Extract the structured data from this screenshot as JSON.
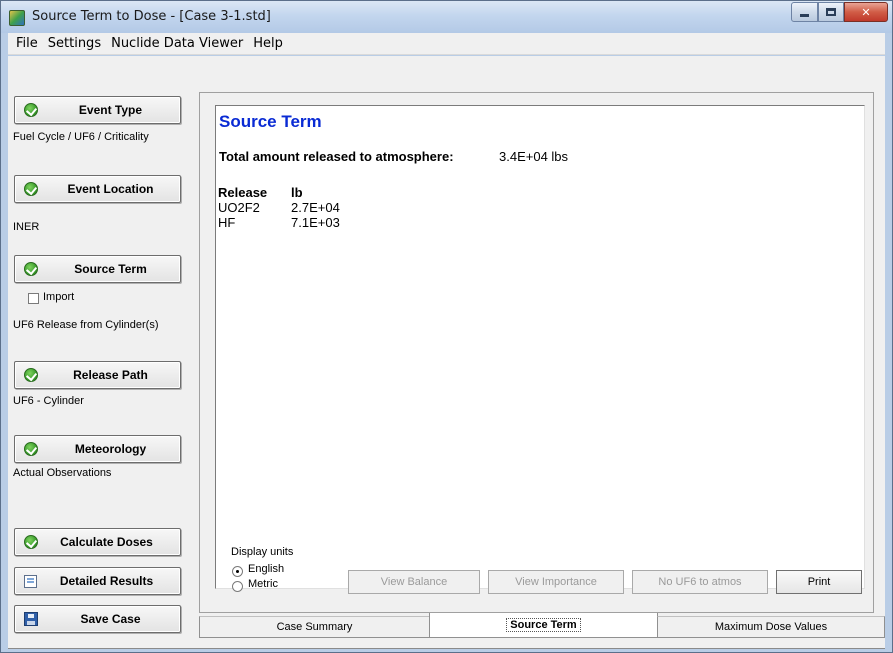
{
  "window": {
    "title": "Source Term to Dose - [Case 3-1.std]"
  },
  "menu": [
    "File",
    "Settings",
    "Nuclide Data Viewer",
    "Help"
  ],
  "steps": {
    "event_type": {
      "label": "Event Type",
      "description": "Fuel Cycle / UF6 / Criticality"
    },
    "event_location": {
      "label": "Event Location",
      "description": "INER"
    },
    "source_term": {
      "label": "Source Term",
      "description": "UF6 Release from Cylinder(s)"
    },
    "import": {
      "label": "Import",
      "checked": false
    },
    "release_path": {
      "label": "Release Path",
      "description": "UF6 - Cylinder"
    },
    "meteorology": {
      "label": "Meteorology",
      "description": "Actual Observations"
    }
  },
  "actions": {
    "calculate": "Calculate Doses",
    "detailed_results": "Detailed Results",
    "save_case": "Save Case"
  },
  "report": {
    "title": "Source Term",
    "total_label": "Total amount released to atmosphere:",
    "total_value": "3.4E+04 lbs",
    "columns": [
      "Release",
      "lb"
    ],
    "rows": [
      {
        "name": "UO2F2",
        "value": "2.7E+04"
      },
      {
        "name": "HF",
        "value": "7.1E+03"
      }
    ]
  },
  "display_units": {
    "title": "Display units",
    "options": [
      "English",
      "Metric"
    ],
    "selected": "English"
  },
  "buttons": {
    "view_balance": "View Balance",
    "view_importance": "View Importance",
    "no_uf6": "No UF6 to atmos",
    "print": "Print"
  },
  "tabs": [
    {
      "label": "Case Summary",
      "selected": false
    },
    {
      "label": "Source Term",
      "selected": true
    },
    {
      "label": "Maximum Dose Values",
      "selected": false
    }
  ],
  "colors": {
    "report_title": "#0a2bd4",
    "check_green": "#3a9c2c",
    "window_frame": "#b9cde6"
  }
}
